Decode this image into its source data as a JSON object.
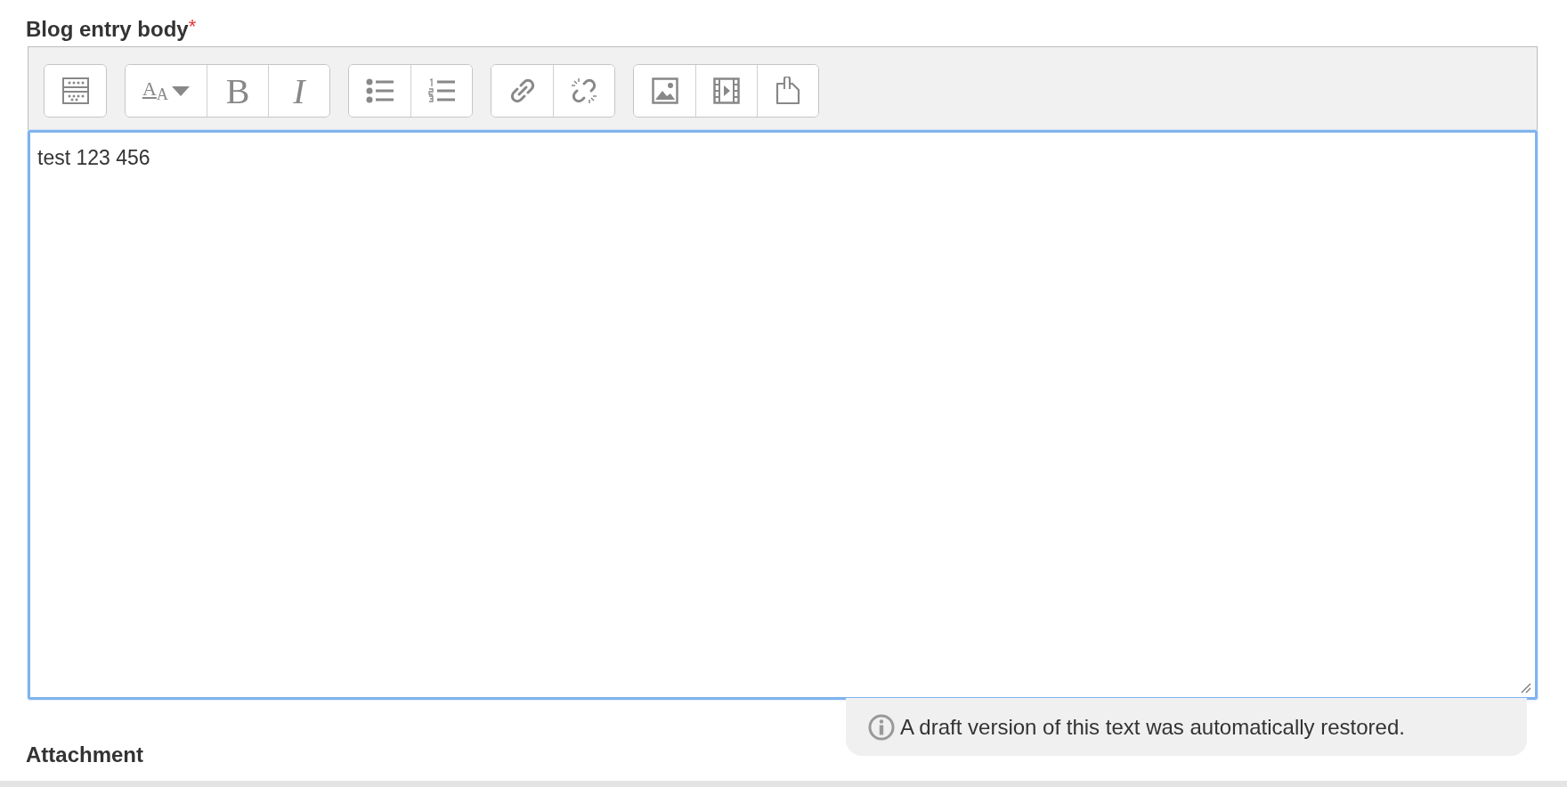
{
  "field_label": {
    "text": "Blog entry body",
    "required_mark": "*"
  },
  "toolbar": {
    "groups": [
      {
        "buttons": [
          {
            "kind": "collapse"
          }
        ]
      },
      {
        "buttons": [
          {
            "kind": "style",
            "label": "A$_{A}$"
          },
          {
            "kind": "bold",
            "label": "B"
          },
          {
            "kind": "italic",
            "label": "I"
          }
        ]
      },
      {
        "buttons": [
          {
            "kind": "bullets"
          },
          {
            "kind": "numbered"
          }
        ]
      },
      {
        "buttons": [
          {
            "kind": "link"
          },
          {
            "kind": "unlink"
          }
        ]
      },
      {
        "buttons": [
          {
            "kind": "image"
          },
          {
            "kind": "media"
          },
          {
            "kind": "files"
          }
        ]
      }
    ]
  },
  "editor": {
    "value": "test 123 456",
    "focused": true
  },
  "notice": {
    "text": "A draft version of this text was automatically restored."
  },
  "next_label": {
    "text": "Attachment"
  }
}
